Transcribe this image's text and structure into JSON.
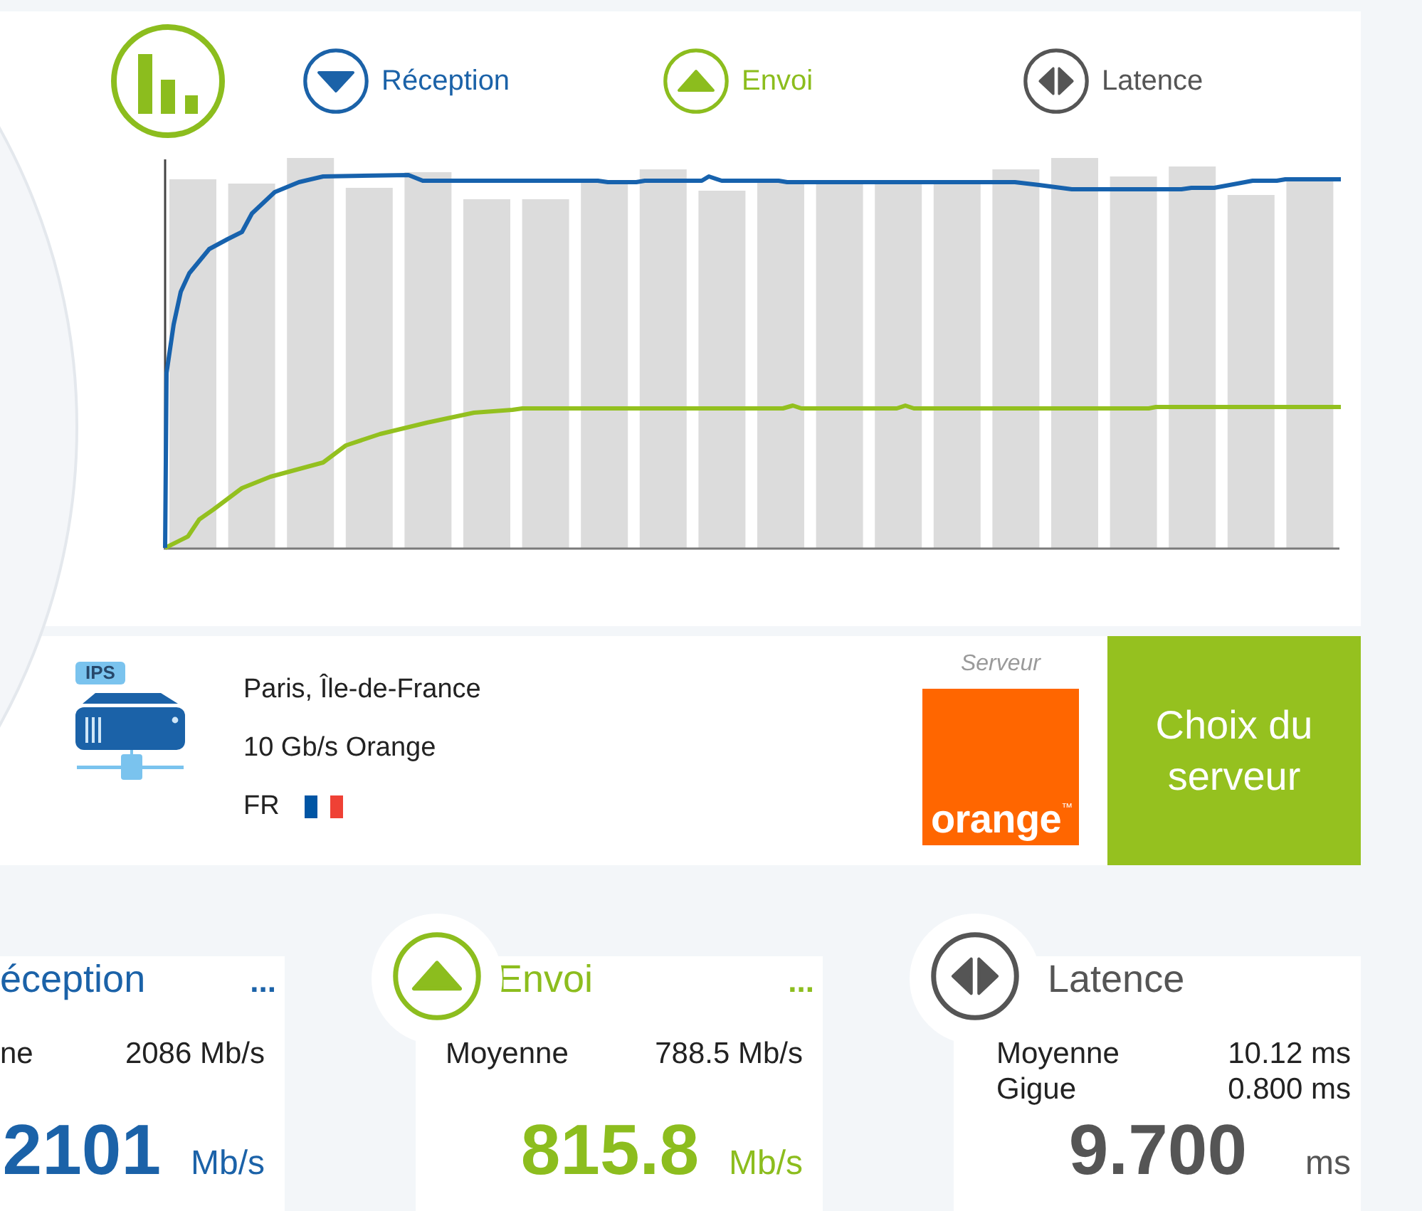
{
  "chart_header": {
    "legend": [
      {
        "kind": "download",
        "label": "Réception"
      },
      {
        "kind": "upload",
        "label": "Envoi"
      },
      {
        "kind": "latency",
        "label": "Latence"
      }
    ]
  },
  "server_panel": {
    "badge": "IPS",
    "lines": [
      "Paris, Île-de-France",
      "10 Gb/s Orange"
    ],
    "country": "FR",
    "caption": "Serveur",
    "logo": "orange$^{™}$",
    "button": "Choix du serveur"
  },
  "results": [
    {
      "kind": "download",
      "clipped": true,
      "title": "éception",
      "more": "...",
      "stats": [
        {
          "label": "ne",
          "value": "2086 Mb/s"
        }
      ],
      "value": "2101",
      "unit": "Mb/s"
    },
    {
      "kind": "upload",
      "clipped": false,
      "title": "Envoi",
      "more": "...",
      "stats": [
        {
          "label": "Moyenne",
          "value": "788.5 Mb/s"
        }
      ],
      "value": "815.8",
      "unit": "Mb/s"
    },
    {
      "kind": "latency",
      "clipped": false,
      "title": "Latence",
      "stats": [
        {
          "label": "Moyenne",
          "value": "10.12 ms"
        },
        {
          "label": "Gigue",
          "value": "0.800 ms"
        }
      ],
      "value": "9.700",
      "unit": "ms"
    }
  ]
}
